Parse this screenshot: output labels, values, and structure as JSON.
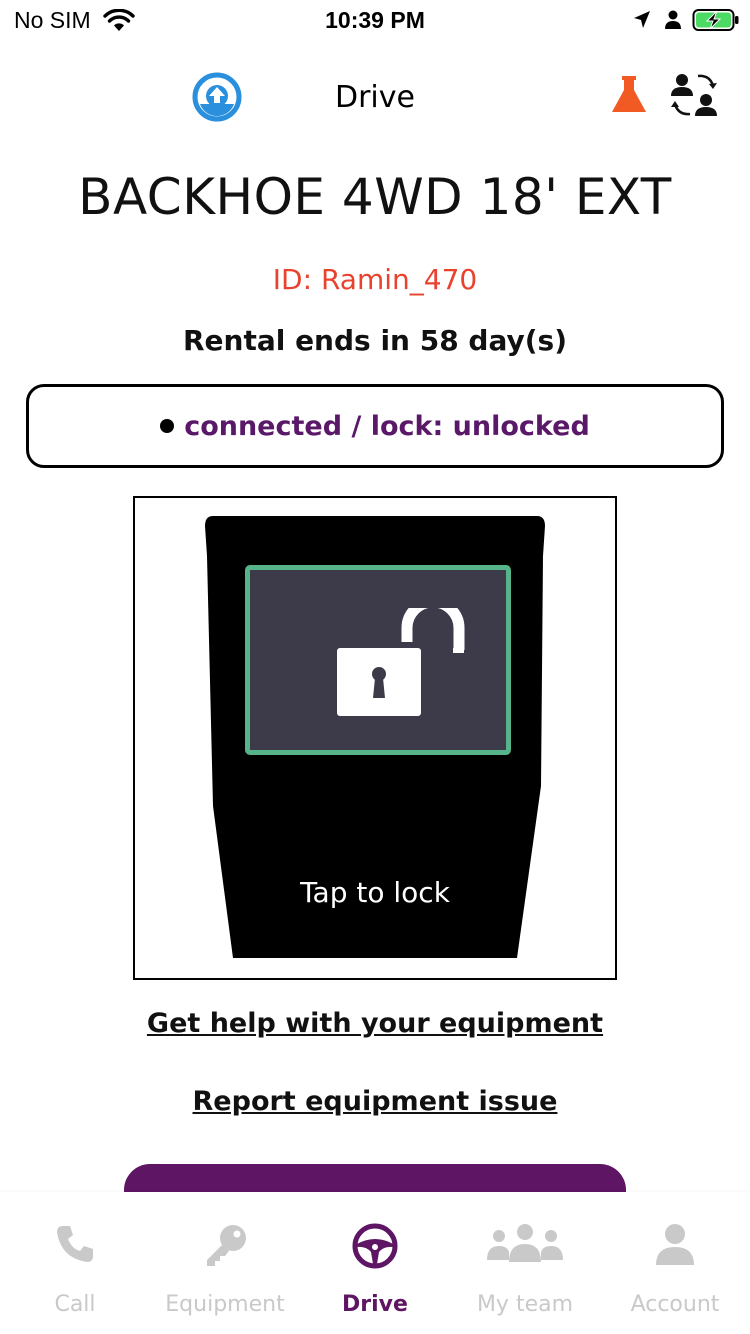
{
  "status_bar": {
    "carrier": "No SIM",
    "time": "10:39 PM"
  },
  "header": {
    "title": "Drive",
    "icons": [
      "upload-icon",
      "flask-icon",
      "switch-user-icon"
    ]
  },
  "equipment": {
    "name": "BACKHOE 4WD 18' EXT",
    "id": "ID: Ramin_470",
    "rental": "Rental ends in 58 day(s)"
  },
  "connection": {
    "status_text": "connected / lock: unlocked"
  },
  "lock_panel": {
    "state_icon": "unlocked-padlock-icon",
    "tap_label": "Tap to lock"
  },
  "links": {
    "help": "Get help with your equipment",
    "report": "Report equipment issue"
  },
  "tabs": [
    {
      "label": "Call",
      "icon": "phone-icon",
      "active": false
    },
    {
      "label": "Equipment",
      "icon": "key-icon",
      "active": false
    },
    {
      "label": "Drive",
      "icon": "steering-wheel-icon",
      "active": true
    },
    {
      "label": "My team",
      "icon": "team-icon",
      "active": false
    },
    {
      "label": "Account",
      "icon": "account-icon",
      "active": false
    }
  ],
  "colors": {
    "brand_purple": "#5e1664",
    "id_red": "#e8432f",
    "lock_border_green": "#56b38a",
    "flask_orange": "#f15a22",
    "upload_blue": "#2a8fdc",
    "inactive_tab": "#c9c9c9"
  }
}
